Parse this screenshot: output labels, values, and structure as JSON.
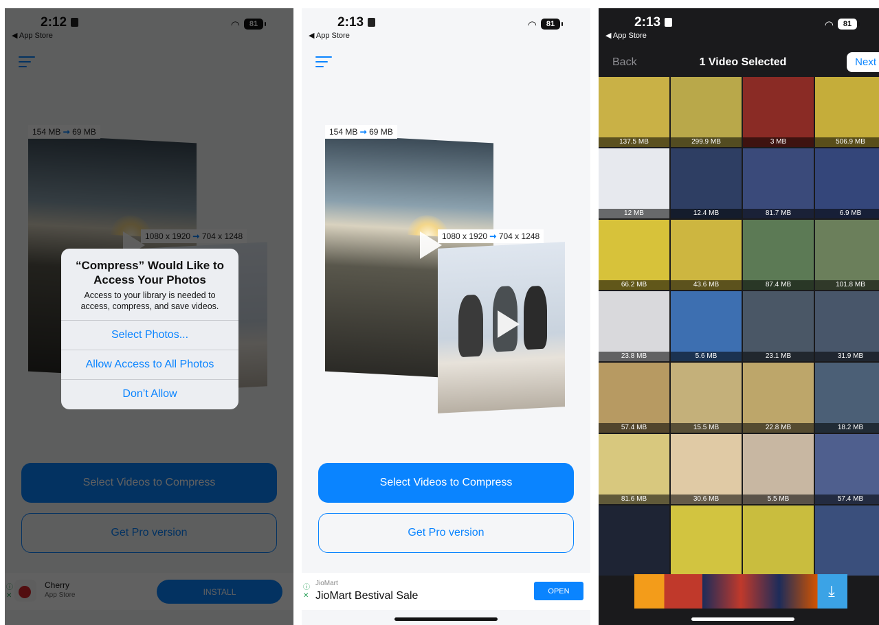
{
  "panel1": {
    "time": "2:12",
    "back_app": "◀ App Store",
    "battery": "81",
    "size_tag": {
      "from": "154 MB",
      "to": "69 MB"
    },
    "res_tag": {
      "from": "1080 x 1920",
      "to": "704 x 1248"
    },
    "alert": {
      "title": "“Compress” Would Like to Access Your Photos",
      "message": "Access to your library is needed to access, compress, and save videos.",
      "buttons": [
        "Select Photos...",
        "Allow Access to All Photos",
        "Don’t Allow"
      ]
    },
    "primary_button": "Select Videos to Compress",
    "pro_button": "Get Pro version",
    "ad": {
      "name": "Cherry",
      "source": "App Store",
      "cta": "INSTALL"
    }
  },
  "panel2": {
    "time": "2:13",
    "back_app": "◀ App Store",
    "battery": "81",
    "size_tag": {
      "from": "154 MB",
      "to": "69 MB"
    },
    "res_tag": {
      "from": "1080 x 1920",
      "to": "704 x 1248"
    },
    "primary_button": "Select Videos to Compress",
    "pro_button": "Get Pro version",
    "ad": {
      "brand": "JioMart",
      "headline": "JioMart Bestival Sale",
      "cta": "OPEN"
    }
  },
  "panel3": {
    "time": "2:13",
    "back_app": "◀ App Store",
    "battery": "81",
    "nav": {
      "back": "Back",
      "title": "1 Video Selected",
      "next": "Next"
    },
    "videos": [
      {
        "size": "137.5 MB",
        "color": "#c9b146"
      },
      {
        "size": "299.9 MB",
        "color": "#b9a84a"
      },
      {
        "size": "3 MB",
        "color": "#8a2b25"
      },
      {
        "size": "506.9 MB",
        "color": "#c5ad3a"
      },
      {
        "size": "12 MB",
        "color": "#e7e9ee"
      },
      {
        "size": "12.4 MB",
        "color": "#2e3e63"
      },
      {
        "size": "81.7 MB",
        "color": "#3a4a7a"
      },
      {
        "size": "6.9 MB",
        "color": "#34467a"
      },
      {
        "size": "66.2 MB",
        "color": "#d7c23a"
      },
      {
        "size": "43.6 MB",
        "color": "#cdb640"
      },
      {
        "size": "87.4 MB",
        "color": "#5c7a55"
      },
      {
        "size": "101.8 MB",
        "color": "#6b7f5b"
      },
      {
        "size": "23.8 MB",
        "color": "#d9d9dc"
      },
      {
        "size": "5.6 MB",
        "color": "#3d6fb1"
      },
      {
        "size": "23.1 MB",
        "color": "#4a5766"
      },
      {
        "size": "31.9 MB",
        "color": "#48566a"
      },
      {
        "size": "57.4 MB",
        "color": "#b79a62"
      },
      {
        "size": "15.5 MB",
        "color": "#c4b07a"
      },
      {
        "size": "22.8 MB",
        "color": "#bda66a"
      },
      {
        "size": "18.2 MB",
        "color": "#4b5f76"
      },
      {
        "size": "81.6 MB",
        "color": "#d8c87e"
      },
      {
        "size": "30.6 MB",
        "color": "#e0caa5"
      },
      {
        "size": "5.5 MB",
        "color": "#c8b7a2"
      },
      {
        "size": "57.4 MB",
        "color": "#4f5f8e"
      },
      {
        "size": "",
        "color": "#1e2434"
      },
      {
        "size": "",
        "color": "#d2c440"
      },
      {
        "size": "",
        "color": "#c9bd3e"
      },
      {
        "size": "",
        "color": "#3a4f7c"
      }
    ]
  }
}
